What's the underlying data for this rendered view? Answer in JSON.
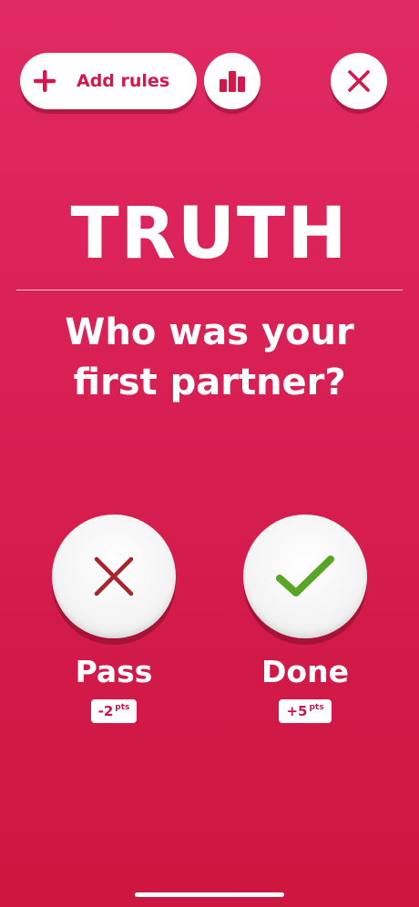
{
  "toolbar": {
    "add_rules_label": "Add rules"
  },
  "card": {
    "category": "TRUTH",
    "question": "Who was your first partner?"
  },
  "actions": {
    "pass": {
      "label": "Pass",
      "points": "-2",
      "points_unit": "pts"
    },
    "done": {
      "label": "Done",
      "points": "+5",
      "points_unit": "pts"
    }
  },
  "colors": {
    "background": "#d81f53",
    "accent": "#d4184c",
    "pass_icon": "#a8232c",
    "done_icon": "#5aa526"
  },
  "icons": {
    "add": "plus-icon",
    "stats": "bar-chart-icon",
    "close": "close-icon",
    "pass": "x-mark-icon",
    "done": "check-mark-icon"
  }
}
